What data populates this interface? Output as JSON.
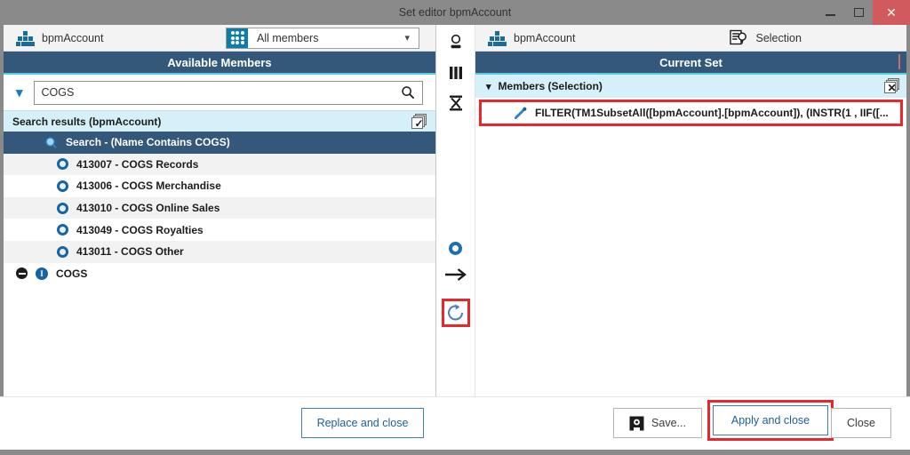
{
  "window": {
    "title": "Set editor bpmAccount",
    "controls": {
      "minimize": "minimize-button",
      "maximize": "maximize-button",
      "close": "close-button"
    }
  },
  "left_panel": {
    "dimension": "bpmAccount",
    "member_filter": {
      "value": "All members",
      "options": [
        "All members"
      ]
    },
    "header": "Available Members",
    "search": {
      "value": "COGS",
      "placeholder": ""
    },
    "results_header": "Search results (bpmAccount)",
    "rows": [
      {
        "label": "Search - (Name Contains COGS)",
        "icon": "search-result-icon",
        "indent": 1,
        "selected": true,
        "striped": false
      },
      {
        "label": "413007 - COGS Records",
        "icon": "member-ring-icon",
        "indent": 2,
        "selected": false,
        "striped": true
      },
      {
        "label": "413006 - COGS Merchandise",
        "icon": "member-ring-icon",
        "indent": 2,
        "selected": false,
        "striped": false
      },
      {
        "label": "413010 - COGS Online Sales",
        "icon": "member-ring-icon",
        "indent": 2,
        "selected": false,
        "striped": true
      },
      {
        "label": "413049 - COGS Royalties",
        "icon": "member-ring-icon",
        "indent": 2,
        "selected": false,
        "striped": false
      },
      {
        "label": "413011 - COGS Other",
        "icon": "member-ring-icon",
        "indent": 2,
        "selected": false,
        "striped": true
      },
      {
        "label": "COGS",
        "icon": "collapse-info-icon",
        "indent": 0,
        "selected": false,
        "striped": false
      }
    ]
  },
  "toolbar": {
    "icons": [
      {
        "name": "user-icon"
      },
      {
        "name": "columns-icon"
      },
      {
        "name": "sigma-icon"
      },
      {
        "name": "circle-ring-icon"
      },
      {
        "name": "arrow-right-icon"
      },
      {
        "name": "refresh-icon",
        "highlighted": true
      }
    ]
  },
  "right_panel": {
    "dimension": "bpmAccount",
    "mode": "Selection",
    "header": "Current Set",
    "members_label": "Members (Selection)",
    "expression": "FILTER(TM1SubsetAll([bpmAccount].[bpmAccount]), (INSTR(1 , IIF([..."
  },
  "footer": {
    "replace_and_close": "Replace and close",
    "save": "Save...",
    "apply_and_close": "Apply and close",
    "close": "Close"
  },
  "colors": {
    "header_blue": "#33587a",
    "accent_cyan": "#5bc8e8",
    "panel_cyan": "#d5f0f8",
    "highlight_red": "#e8262b",
    "link_blue": "#1f5e96",
    "teal": "#0c7ea8"
  }
}
